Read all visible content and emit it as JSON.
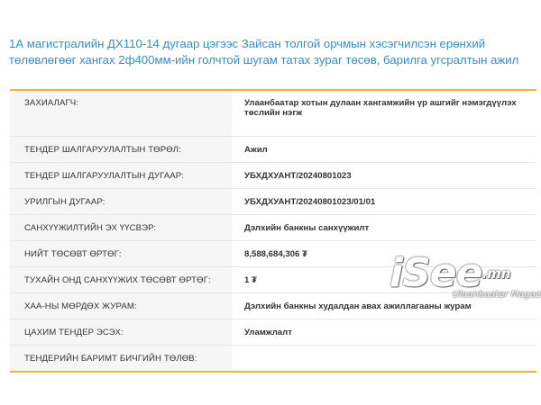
{
  "page": {
    "title": "1А магистралийн ДХ110-14 дугаар цэгээс Зайсан толгой орчмын хэсэгчилсэн ерөнхий төлөвлөгөөг хангах 2ф400мм-ийн голчтой шугам татах зураг төсөв, барилга угсралтын ажил"
  },
  "rows": [
    {
      "label": "ЗАХИАЛАГЧ:",
      "value": "Улаанбаатар хотын дулаан хангамжийн үр ашгийг нэмэгдүүлэх төслийн нэгж"
    },
    {
      "label": "ТЕНДЕР ШАЛГАРУУЛАЛТЫН ТӨРӨЛ:",
      "value": "Ажил"
    },
    {
      "label": "ТЕНДЕР ШАЛГАРУУЛАЛТЫН ДУГААР:",
      "value": "УБХДХУАНТ/20240801023"
    },
    {
      "label": "УРИЛГЫН ДУГААР:",
      "value": "УБХДХУАНТ/20240801023/01/01"
    },
    {
      "label": "САНХҮҮЖИЛТИЙН ЭХ ҮҮСВЭР:",
      "value": "Дэлхийн банкны санхүүжилт"
    },
    {
      "label": "НИЙТ ТӨСӨВТ ӨРТӨГ:",
      "value": "8,588,684,306 ₮"
    },
    {
      "label": "ТУХАЙН ОНД САНХҮҮЖИХ ТӨСӨВТ ӨРТӨГ:",
      "value": "1 ₮"
    },
    {
      "label": "ХАА-НЫ МӨРДӨХ ЖУРАМ:",
      "value": "Дэлхийн банкны худалдан авах ажиллагааны журам"
    },
    {
      "label": "ЦАХИМ ТЕНДЕР ЭСЭХ:",
      "value": "Уламжлалт"
    },
    {
      "label": "ТЕНДЕРИЙН БАРИМТ БИЧГИЙН ТӨЛӨВ:",
      "value": ""
    }
  ],
  "watermark": {
    "main": "iSee",
    "domain": ".mn",
    "sub": "Ulaanbaatar Magazine"
  },
  "colors": {
    "title": "#3a8dc4",
    "table_border": "#f2b23a",
    "label_bg": "#f6f6f6"
  }
}
